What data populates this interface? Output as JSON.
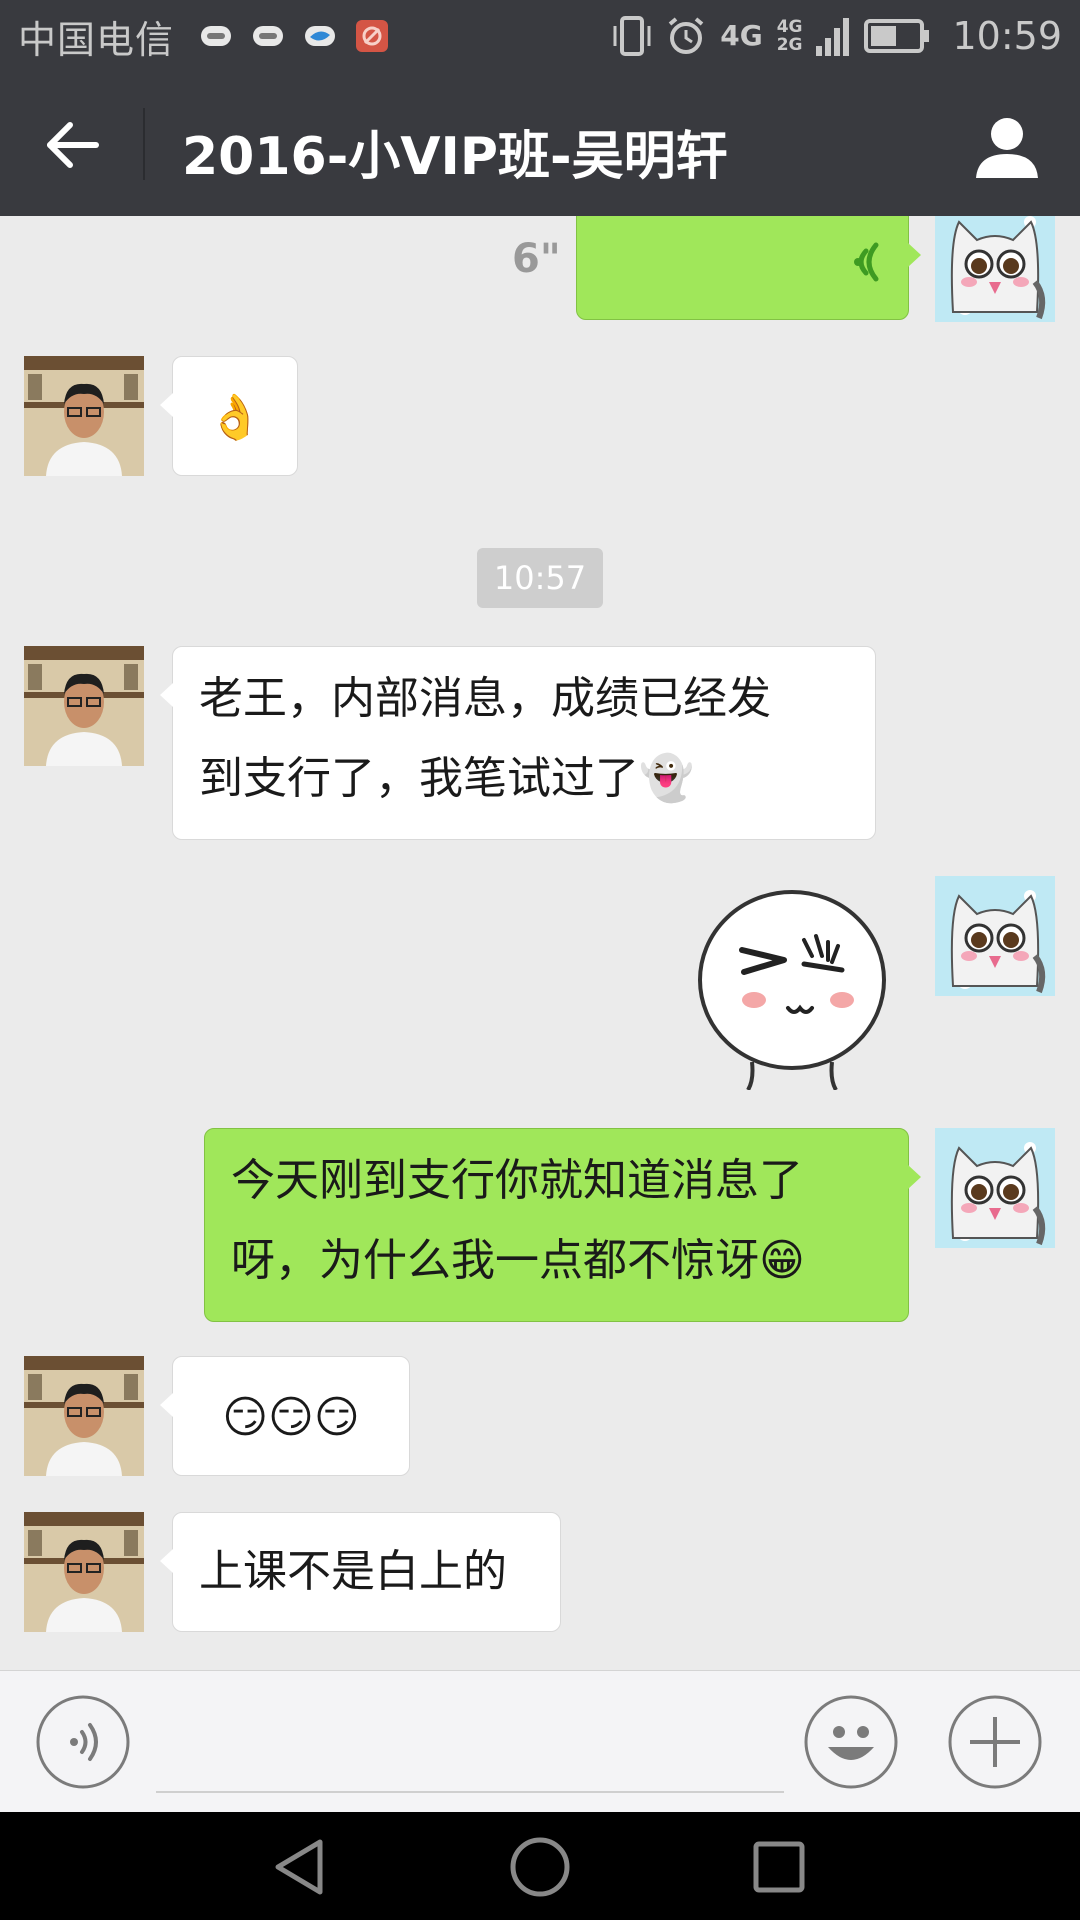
{
  "status_bar": {
    "carrier": "中国电信",
    "network_main": "4G",
    "network_secondary_top": "4G",
    "network_secondary_bottom": "2G",
    "time": "10:59",
    "battery_level": 0.55
  },
  "header": {
    "title": "2016-小VIP班-吴明轩"
  },
  "chat": {
    "voice_message": {
      "duration": "6\""
    },
    "timestamp": "10:57",
    "messages": [
      {
        "sender": "other",
        "type": "emoji",
        "emoji": "👌"
      },
      {
        "sender": "other",
        "type": "text",
        "lines": [
          "老王，内部消息，成绩已经发",
          "到支行了，我笔试过了👻"
        ]
      },
      {
        "sender": "self",
        "type": "sticker",
        "sticker": "squinting-face-sticker"
      },
      {
        "sender": "self",
        "type": "text",
        "lines": [
          "今天刚到支行你就知道消息了",
          "呀，为什么我一点都不惊讶😁"
        ]
      },
      {
        "sender": "other",
        "type": "emoji",
        "emoji": "😏😏😏"
      },
      {
        "sender": "other",
        "type": "text",
        "lines": [
          "上课不是白上的"
        ]
      }
    ]
  },
  "input_bar": {
    "placeholder": ""
  },
  "colors": {
    "toolbar": "#393a3f",
    "background": "#ebebeb",
    "bubble_self": "#a0e75a",
    "bubble_other": "#ffffff",
    "voice_wave": "#3e9b22"
  },
  "icons": {
    "back": "back-arrow-icon",
    "profile": "person-icon",
    "voice": "voice-input-icon",
    "emoji": "smiley-icon",
    "more": "plus-icon"
  }
}
